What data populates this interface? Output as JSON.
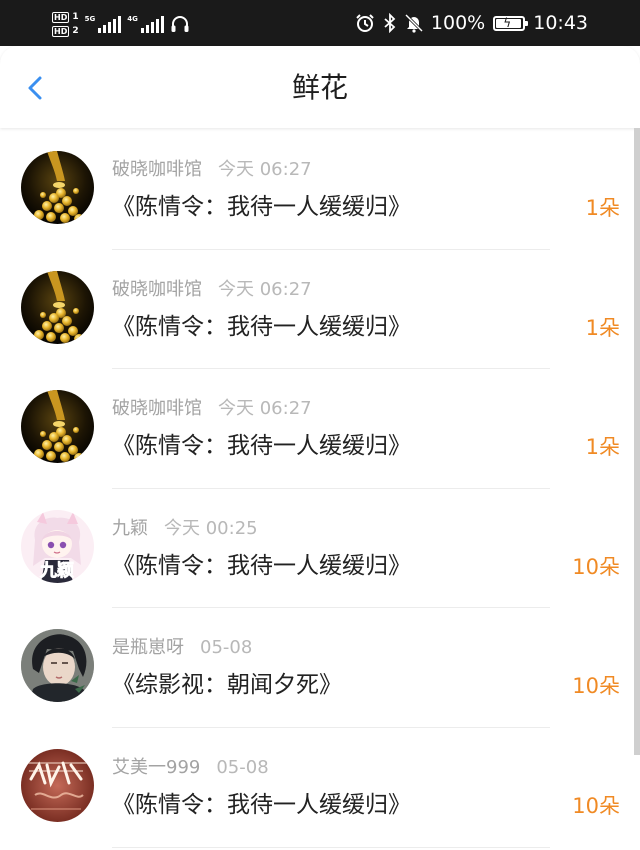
{
  "status_bar": {
    "hd1": "HD",
    "hd1_num": "1",
    "hd2": "HD",
    "hd2_num": "2",
    "net1": "5G",
    "net2": "4G",
    "battery_percent": "100%",
    "battery_level": 1.0,
    "time": "10:43",
    "icons": [
      "alarm-icon",
      "bluetooth-icon",
      "mute-bell-icon",
      "headphones-icon",
      "battery-charging-icon"
    ]
  },
  "header": {
    "title": "鲜花",
    "back_icon": "chevron-left-icon",
    "accent_color": "#3a8ff0"
  },
  "items": [
    {
      "user": "破晓咖啡馆",
      "time": "今天 06:27",
      "book": "《陈情令：我待一人缓缓归》",
      "count": "1朵",
      "avatar": "gold-coins"
    },
    {
      "user": "破晓咖啡馆",
      "time": "今天 06:27",
      "book": "《陈情令：我待一人缓缓归》",
      "count": "1朵",
      "avatar": "gold-coins"
    },
    {
      "user": "破晓咖啡馆",
      "time": "今天 06:27",
      "book": "《陈情令：我待一人缓缓归》",
      "count": "1朵",
      "avatar": "gold-coins"
    },
    {
      "user": "九颖",
      "time": "今天 00:25",
      "book": "《陈情令：我待一人缓缓归》",
      "count": "10朵",
      "avatar": "anime-girl",
      "avatar_text": "九颖"
    },
    {
      "user": "是瓶崽呀",
      "time": "05-08",
      "book": "《综影视：朝闻夕死》",
      "count": "10朵",
      "avatar": "dark-hair-man"
    },
    {
      "user": "艾美一999",
      "time": "05-08",
      "book": "《陈情令：我待一人缓缓归》",
      "count": "10朵",
      "avatar": "red-calligraphy"
    }
  ],
  "colors": {
    "count": "#f08a24",
    "username": "#a3a3a3",
    "book": "#222222"
  }
}
